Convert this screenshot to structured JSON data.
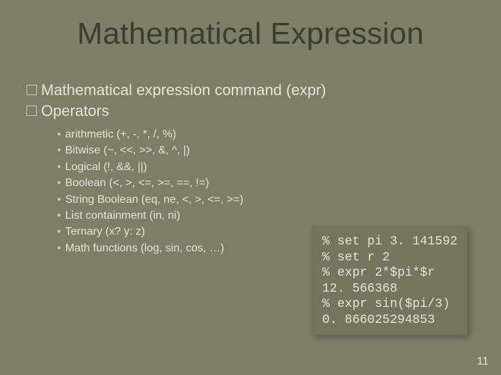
{
  "title": "Mathematical Expression",
  "bullets": {
    "b1": "Mathematical expression command (expr)",
    "b2": "Operators"
  },
  "sub": {
    "s0": "arithmetic (+, -, *, /, %)",
    "s1": "Bitwise (~, <<, >>, &, ^, |)",
    "s2": "Logical (!, &&, ||)",
    "s3": "Boolean (<, >, <=, >=, ==, !=)",
    "s4": "String Boolean (eq, ne, <, >, <=, >=)",
    "s5": "List containment (in, ni)",
    "s6": "Ternary (x? y: z)",
    "s7": "Math functions (log, sin, cos, …)"
  },
  "code": {
    "l0": "% set pi 3. 141592",
    "l1": "% set r 2",
    "l2": "% expr 2*$pi*$r",
    "l3": "12. 566368",
    "l4": "% expr sin($pi/3)",
    "l5": "0. 866025294853"
  },
  "pagenum": "11"
}
